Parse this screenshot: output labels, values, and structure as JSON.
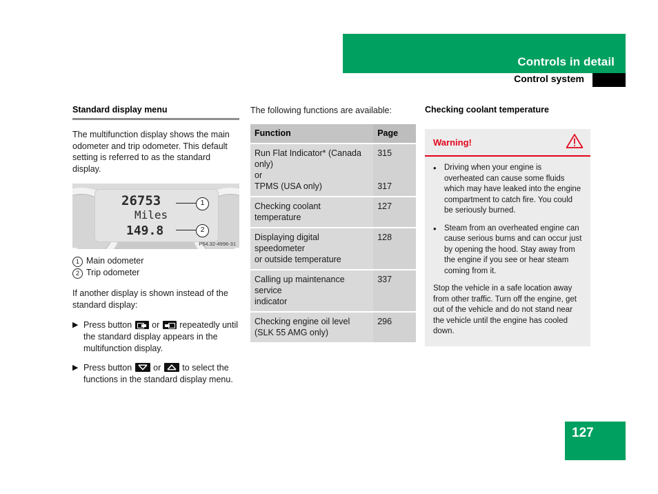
{
  "header": {
    "section_title": "Controls in detail",
    "subsection_title": "Control system"
  },
  "left_column": {
    "section_heading": "Standard display menu",
    "intro_paragraph": "The multifunction display shows the main odometer and trip odometer. This default setting is referred to as the standard display.",
    "figure": {
      "odometer_value": "26753",
      "unit_label": "Miles",
      "trip_value": "149.8",
      "callout_1": "1",
      "callout_2": "2",
      "caption": "P54.32-4996-31"
    },
    "legend": [
      {
        "num": "1",
        "label": "Main odometer"
      },
      {
        "num": "2",
        "label": "Trip odometer"
      }
    ],
    "lead_in": "If another display is shown instead of the standard display:",
    "steps": [
      {
        "arrow": "▶",
        "text_before": "Press button",
        "icon_1": "page-left-button-icon",
        "conjunction": "or",
        "icon_2": "page-right-button-icon",
        "text_after": "repeatedly until the standard display appears in the multifunction display."
      },
      {
        "arrow": "▶",
        "text_before": "Press button",
        "icon_1": "chevron-down-button-icon",
        "conjunction": "or",
        "icon_2": "chevron-up-button-icon",
        "text_after": "to select the functions in the standard display menu."
      }
    ]
  },
  "middle_column": {
    "intro": "The following functions are available:",
    "table": {
      "headers": [
        "Function",
        "Page"
      ],
      "rows": [
        {
          "function_lines": [
            "Run Flat Indicator* (Canada only)",
            "or",
            "TPMS (USA only)"
          ],
          "pages": [
            "315",
            "",
            "317"
          ]
        },
        {
          "function_lines": [
            "Checking coolant temperature"
          ],
          "pages": [
            "127"
          ]
        },
        {
          "function_lines": [
            "Displaying digital speedometer",
            "or outside temperature"
          ],
          "pages": [
            "128"
          ]
        },
        {
          "function_lines": [
            "Calling up maintenance service",
            "indicator"
          ],
          "pages": [
            "337"
          ]
        },
        {
          "function_lines": [
            "Checking engine oil level",
            "(SLK 55 AMG only)"
          ],
          "pages": [
            "296"
          ]
        }
      ]
    }
  },
  "right_column": {
    "section_heading": "Checking coolant temperature",
    "warning": {
      "title": "Warning!",
      "icon": "warning-triangle-icon",
      "bullets": [
        "Driving when your engine is overheated can cause some fluids which may have leaked into the engine compartment to catch fire. You could be seriously burned.",
        "Steam from an overheated engine can cause serious burns and can occur just by opening the hood. Stay away from the engine if you see or hear steam coming from it."
      ],
      "closing_paragraph": "Stop the vehicle in a safe location away from other traffic. Turn off the engine, get out of the vehicle and do not stand near the vehicle until the engine has cooled down."
    }
  },
  "footer": {
    "page_number": "127"
  },
  "colors": {
    "brand_green": "#00A060",
    "warning_red": "#E3051C",
    "table_header_gray": "#C4C4C4",
    "table_row_gray": "#D9D9D9",
    "warning_box_gray": "#ECECEC"
  }
}
